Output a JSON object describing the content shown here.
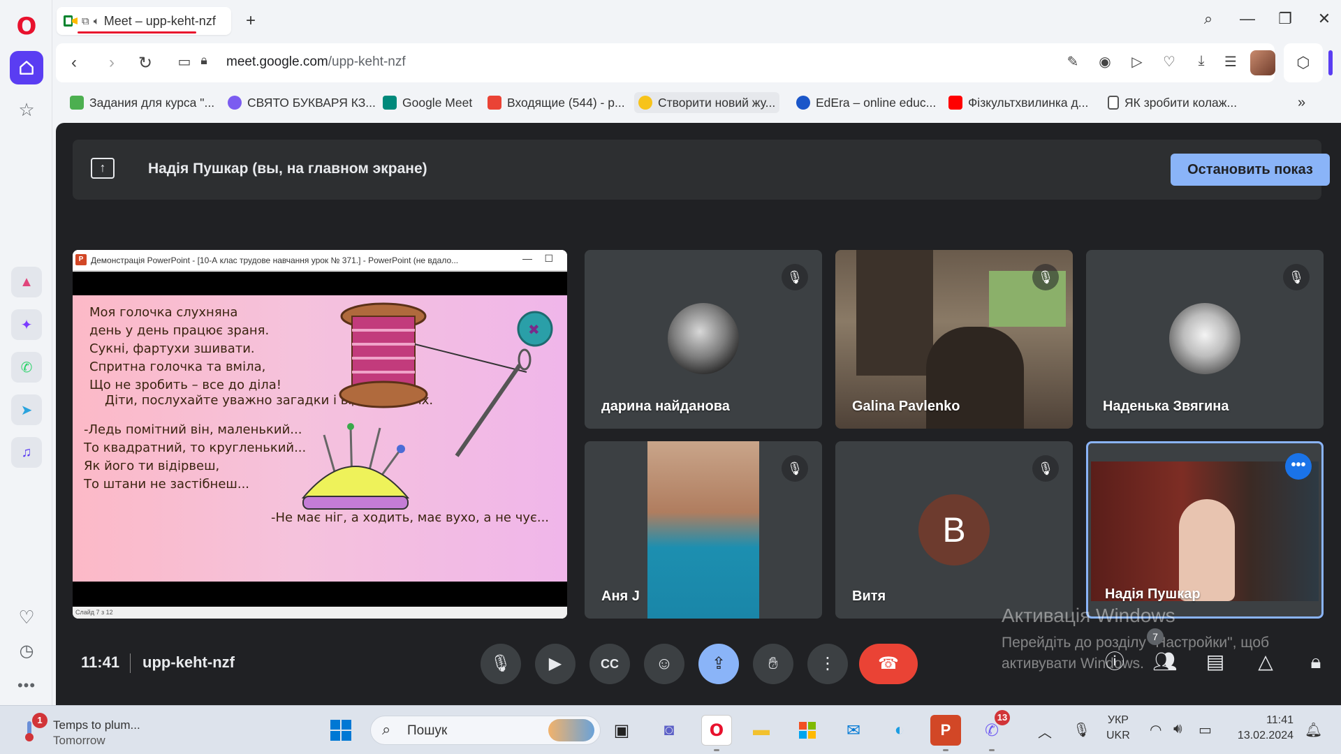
{
  "browser": {
    "tab": {
      "title": "Meet – upp-keht-nzf"
    },
    "address": {
      "host": "meet.google.com",
      "path": "/upp-keht-nzf"
    }
  },
  "bookmarks": [
    {
      "label": "Задания для курса \"...",
      "color": "#4caf50"
    },
    {
      "label": "СВЯТО БУКВАРЯ КЗ...",
      "color": "#7b5cf0"
    },
    {
      "label": "Google Meet",
      "color": "#00897b"
    },
    {
      "label": "Входящие (544) - р...",
      "color": "#ea4335"
    },
    {
      "label": "Створити новий жу...",
      "color": "#f7c31a"
    },
    {
      "label": "EdEra – online educ...",
      "color": "#1a56c9"
    },
    {
      "label": "Фізкультхвилинка д...",
      "color": "#ff0000"
    },
    {
      "label": "ЯК зробити колаж...",
      "color": "#555555"
    }
  ],
  "meet": {
    "banner_text": "Надія Пушкар (вы, на главном экране)",
    "stop_button": "Остановить показ",
    "time": "11:41",
    "code": "upp-keht-nzf",
    "people_count": "7",
    "presentation": {
      "window_title": "Демонстрація PowerPoint - [10-А клас трудове навчання урок № 371.] - PowerPoint (не вдало...",
      "poem_1": "Моя голочка слухняна\nдень у день працює зраня.\nСукні, фартухи зшивати.\nСпритна голочка та вміла,\nЩо не зробить – все до діла!",
      "line_instruction": "Діти, послухайте уважно загадки і відгадайте їх.",
      "riddle": "-Ледь помітний він, маленький...\nТо квадратний, то кругленький...\nЯк його ти відірвеш,\nТо штани не застібнеш...",
      "riddle_2": "-Не має ніг, а ходить, має вухо, а не чує...",
      "status": "Слайд 7 з 12"
    },
    "participants": [
      {
        "name": "дарина найданова"
      },
      {
        "name": "Galina Pavlenko"
      },
      {
        "name": "Наденька Звягина"
      },
      {
        "name": "Аня J"
      },
      {
        "name": "Витя",
        "initial": "B"
      },
      {
        "name": "Надія Пушкар"
      }
    ],
    "watermark": {
      "title": "Активація Windows",
      "body": "Перейдіть до розділу \"Настройки\", щоб активувати Windows."
    }
  },
  "taskbar": {
    "weather_line1": "Temps to plum...",
    "weather_line2": "Tomorrow",
    "weather_badge": "1",
    "search_placeholder": "Пошук",
    "viber_badge": "13",
    "lang_1": "УКР",
    "lang_2": "UKR",
    "clock_time": "11:41",
    "clock_date": "13.02.2024"
  }
}
